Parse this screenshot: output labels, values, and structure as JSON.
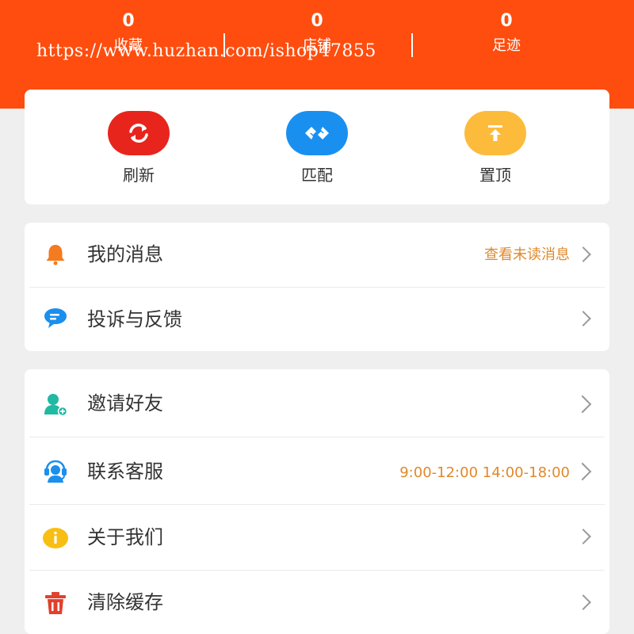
{
  "header": {
    "stats": [
      {
        "count": "0",
        "label": "收藏"
      },
      {
        "count": "0",
        "label": "店铺"
      },
      {
        "count": "0",
        "label": "足迹"
      }
    ],
    "watermark": "https://www.huzhan.com/ishop47855",
    "background_color": "#fe4d0e"
  },
  "actions": [
    {
      "label": "刷新",
      "icon": "refresh-icon",
      "color": "#e8251c"
    },
    {
      "label": "匹配",
      "icon": "match-icon",
      "color": "#1990f0"
    },
    {
      "label": "置顶",
      "icon": "pin-top-icon",
      "color": "#fdbb3c"
    }
  ],
  "messages": {
    "items": [
      {
        "label": "我的消息",
        "hint": "查看未读消息",
        "icon": "bell-icon"
      },
      {
        "label": "投诉与反馈",
        "hint": "",
        "icon": "chat-bubble-icon"
      }
    ]
  },
  "more": {
    "items": [
      {
        "label": "邀请好友",
        "hint": "",
        "icon": "add-friend-icon"
      },
      {
        "label": "联系客服",
        "hint": "9:00-12:00 14:00-18:00",
        "icon": "headset-icon"
      },
      {
        "label": "关于我们",
        "hint": "",
        "icon": "info-icon"
      },
      {
        "label": "清除缓存",
        "hint": "",
        "icon": "trash-icon"
      }
    ]
  },
  "colors": {
    "accent": "#fe4d0e",
    "hint": "#e0892b"
  }
}
